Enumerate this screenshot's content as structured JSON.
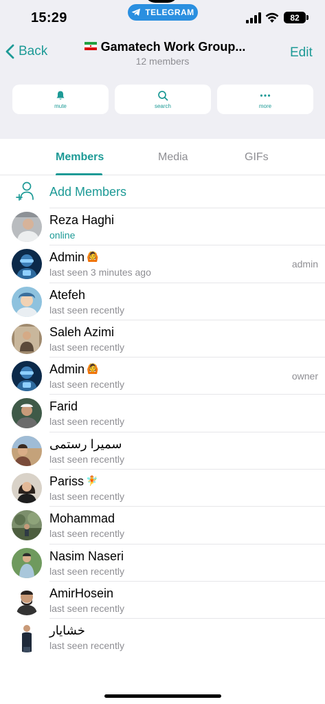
{
  "status_bar": {
    "time": "15:29",
    "app_pill": "TELEGRAM",
    "battery": "82"
  },
  "nav": {
    "back_label": "Back",
    "title": "Gamatech Work Group...",
    "subtitle": "12 members",
    "edit_label": "Edit"
  },
  "actions": [
    {
      "label": "mute",
      "icon": "bell-icon"
    },
    {
      "label": "search",
      "icon": "search-icon"
    },
    {
      "label": "more",
      "icon": "more-dots-icon"
    }
  ],
  "tabs": [
    {
      "label": "Members",
      "active": true
    },
    {
      "label": "Media",
      "active": false
    },
    {
      "label": "GIFs",
      "active": false
    }
  ],
  "add_members": {
    "label": "Add Members",
    "icon": "add-person-icon"
  },
  "members": [
    {
      "name": "Reza Haghi",
      "status": "online",
      "role": "",
      "emoji": ""
    },
    {
      "name": "Admin",
      "status": "last seen 3 minutes ago",
      "role": "admin",
      "emoji": "🙆"
    },
    {
      "name": "Atefeh",
      "status": "last seen recently",
      "role": "",
      "emoji": ""
    },
    {
      "name": "Saleh Azimi",
      "status": "last seen recently",
      "role": "",
      "emoji": ""
    },
    {
      "name": "Admin",
      "status": "last seen recently",
      "role": "owner",
      "emoji": "🙆"
    },
    {
      "name": "Farid",
      "status": "last seen recently",
      "role": "",
      "emoji": ""
    },
    {
      "name": "سمیرا رستمی",
      "status": "last seen recently",
      "role": "",
      "emoji": ""
    },
    {
      "name": "Pariss",
      "status": "last seen recently",
      "role": "",
      "emoji": "🧚"
    },
    {
      "name": "Mohammad",
      "status": "last seen recently",
      "role": "",
      "emoji": ""
    },
    {
      "name": "Nasim Naseri",
      "status": "last seen recently",
      "role": "",
      "emoji": ""
    },
    {
      "name": "AmirHosein",
      "status": "last seen recently",
      "role": "",
      "emoji": ""
    },
    {
      "name": "خشایار",
      "status": "last seen recently",
      "role": "",
      "emoji": ""
    }
  ],
  "colors": {
    "accent": "#1d9a96",
    "telegram_blue": "#2a8fe0",
    "header_bg": "#efeff4",
    "secondary_text": "#8e8e93"
  }
}
